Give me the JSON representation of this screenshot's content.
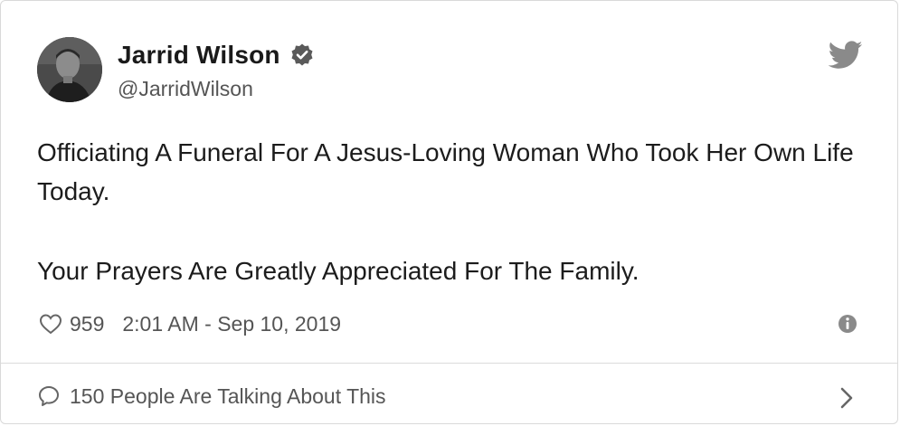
{
  "author": {
    "name": "Jarrid Wilson",
    "handle": "@JarridWilson",
    "verified": true
  },
  "icons": {
    "verified": "verified-badge-icon",
    "brand": "twitter-bird-icon",
    "like": "heart-icon",
    "info": "info-icon",
    "reply": "speech-bubble-icon",
    "more": "chevron-right-icon"
  },
  "tweet": {
    "line1": "Officiating A Funeral For A Jesus-Loving Woman Who Took Her Own Life Today.",
    "line2": "Your Prayers Are Greatly Appreciated For The Family."
  },
  "meta": {
    "likes": "959",
    "timestamp": "2:01 AM - Sep 10, 2019"
  },
  "footer": {
    "label": "150 People Are Talking About This"
  },
  "colors": {
    "text": "#1c1c1c",
    "secondary": "#555555",
    "divider": "#dcdcdc"
  }
}
